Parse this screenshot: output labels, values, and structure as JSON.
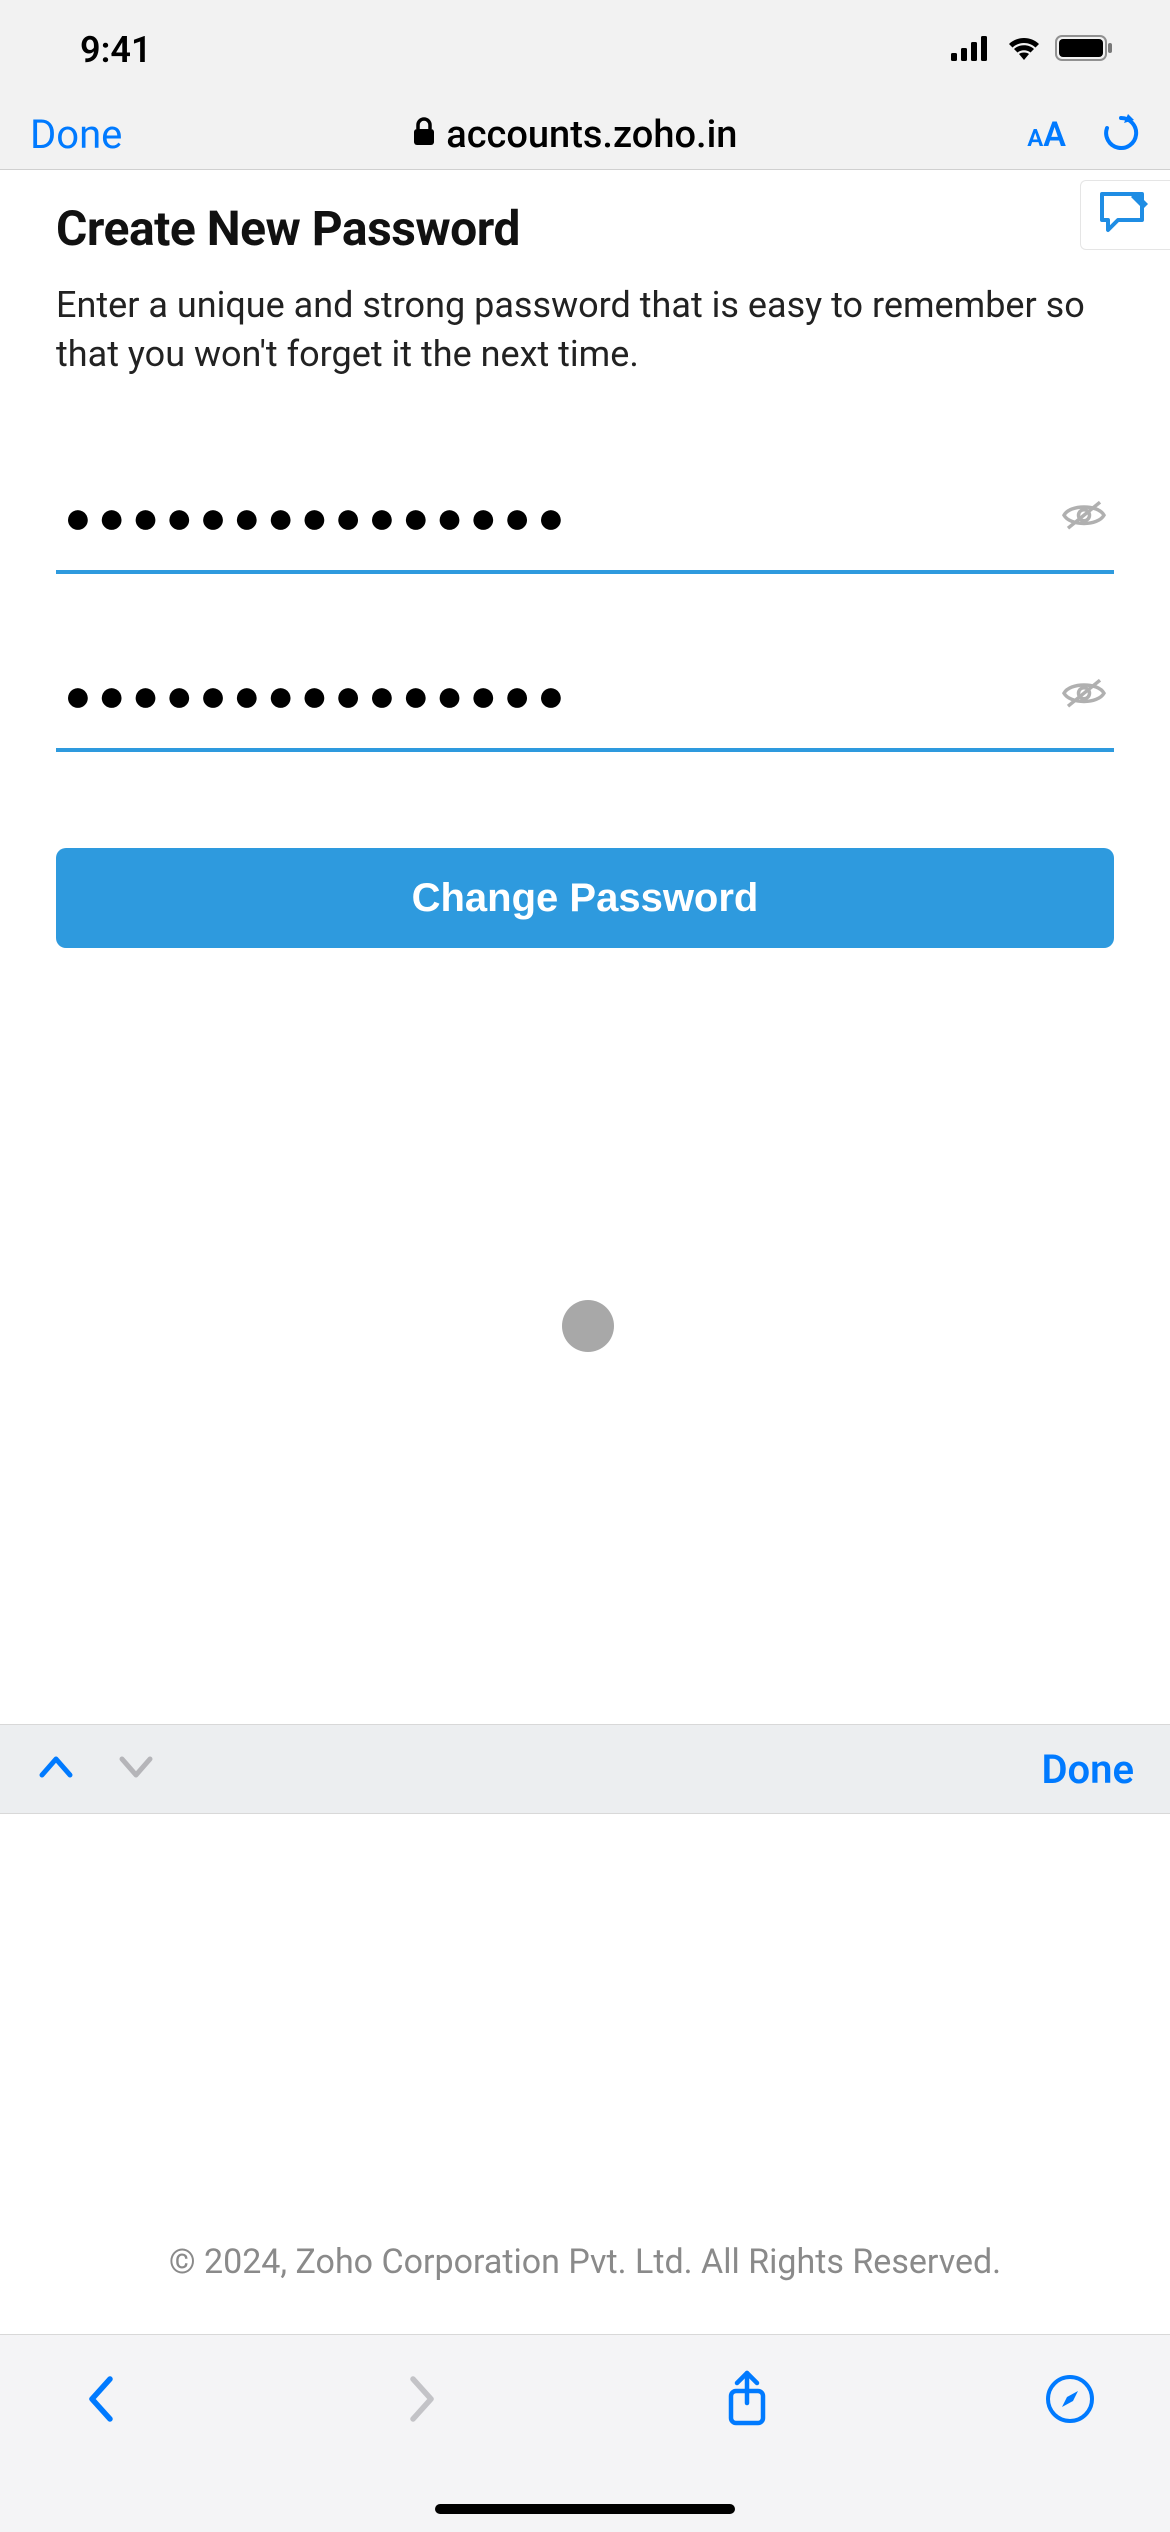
{
  "status": {
    "time": "9:41"
  },
  "safari": {
    "done": "Done",
    "url": "accounts.zoho.in"
  },
  "page": {
    "title": "Create New Password",
    "subtitle": "Enter a unique and strong password that is easy to remember so that you won't forget it the next time.",
    "password_value": "●●●●●●●●●●●●●●●",
    "confirm_value": "●●●●●●●●●●●●●●●",
    "submit": "Change Password",
    "footer": "© 2024, Zoho Corporation Pvt. Ltd. All Rights Reserved."
  },
  "kbd": {
    "done": "Done"
  },
  "colors": {
    "ios_blue": "#007aff",
    "accent_blue": "#2e9ade"
  }
}
